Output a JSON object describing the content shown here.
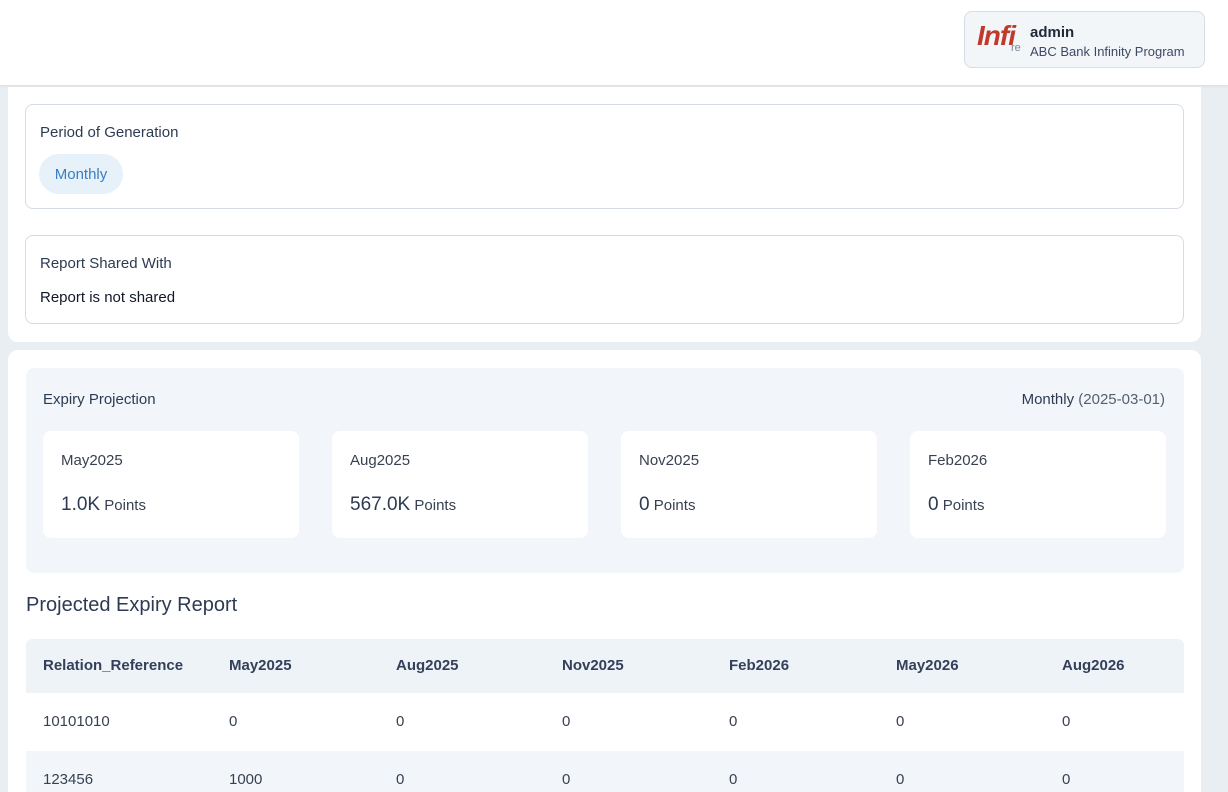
{
  "header": {
    "logo_text": "Infi",
    "logo_sub": "re",
    "user_name": "admin",
    "program_name": "ABC Bank Infinity Program"
  },
  "period": {
    "label": "Period of Generation",
    "value": "Monthly"
  },
  "shared": {
    "label": "Report Shared With",
    "value": "Report is not shared"
  },
  "expiry_projection": {
    "title": "Expiry Projection",
    "period_label": "Monthly",
    "period_date": "(2025-03-01)",
    "cards": [
      {
        "month": "May2025",
        "value": "1.0K",
        "unit": "Points"
      },
      {
        "month": "Aug2025",
        "value": "567.0K",
        "unit": "Points"
      },
      {
        "month": "Nov2025",
        "value": "0",
        "unit": "Points"
      },
      {
        "month": "Feb2026",
        "value": "0",
        "unit": "Points"
      }
    ]
  },
  "report": {
    "title": "Projected Expiry Report",
    "columns": [
      "Relation_Reference",
      "May2025",
      "Aug2025",
      "Nov2025",
      "Feb2026",
      "May2026",
      "Aug2026"
    ],
    "rows": [
      [
        "10101010",
        "0",
        "0",
        "0",
        "0",
        "0",
        "0"
      ],
      [
        "123456",
        "1000",
        "0",
        "0",
        "0",
        "0",
        "0"
      ]
    ]
  },
  "colors": {
    "accent": "#3a7ec2",
    "logo_red": "#c0392b",
    "page_bg": "#e9eef3",
    "tint_bg": "#f2f6fa"
  }
}
